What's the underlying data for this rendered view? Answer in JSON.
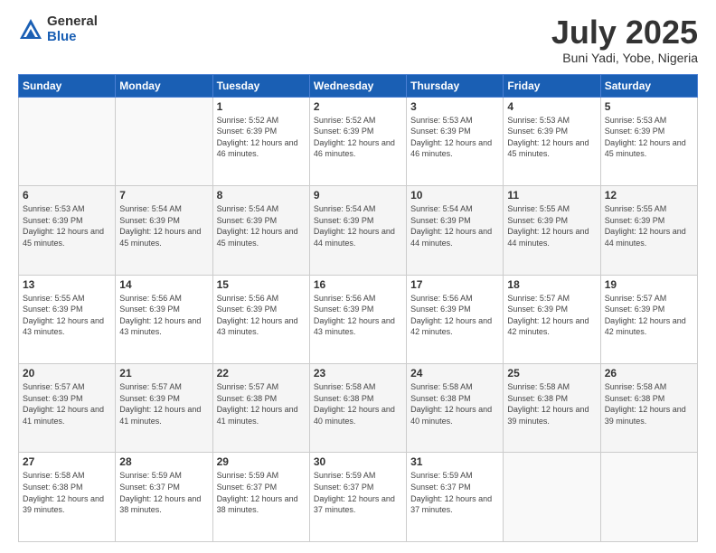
{
  "logo": {
    "general": "General",
    "blue": "Blue"
  },
  "header": {
    "month": "July 2025",
    "location": "Buni Yadi, Yobe, Nigeria"
  },
  "weekdays": [
    "Sunday",
    "Monday",
    "Tuesday",
    "Wednesday",
    "Thursday",
    "Friday",
    "Saturday"
  ],
  "days": [
    {
      "date": null
    },
    {
      "date": null
    },
    {
      "date": 1,
      "sunrise": "Sunrise: 5:52 AM",
      "sunset": "Sunset: 6:39 PM",
      "daylight": "Daylight: 12 hours and 46 minutes."
    },
    {
      "date": 2,
      "sunrise": "Sunrise: 5:52 AM",
      "sunset": "Sunset: 6:39 PM",
      "daylight": "Daylight: 12 hours and 46 minutes."
    },
    {
      "date": 3,
      "sunrise": "Sunrise: 5:53 AM",
      "sunset": "Sunset: 6:39 PM",
      "daylight": "Daylight: 12 hours and 46 minutes."
    },
    {
      "date": 4,
      "sunrise": "Sunrise: 5:53 AM",
      "sunset": "Sunset: 6:39 PM",
      "daylight": "Daylight: 12 hours and 45 minutes."
    },
    {
      "date": 5,
      "sunrise": "Sunrise: 5:53 AM",
      "sunset": "Sunset: 6:39 PM",
      "daylight": "Daylight: 12 hours and 45 minutes."
    },
    {
      "date": 6,
      "sunrise": "Sunrise: 5:53 AM",
      "sunset": "Sunset: 6:39 PM",
      "daylight": "Daylight: 12 hours and 45 minutes."
    },
    {
      "date": 7,
      "sunrise": "Sunrise: 5:54 AM",
      "sunset": "Sunset: 6:39 PM",
      "daylight": "Daylight: 12 hours and 45 minutes."
    },
    {
      "date": 8,
      "sunrise": "Sunrise: 5:54 AM",
      "sunset": "Sunset: 6:39 PM",
      "daylight": "Daylight: 12 hours and 45 minutes."
    },
    {
      "date": 9,
      "sunrise": "Sunrise: 5:54 AM",
      "sunset": "Sunset: 6:39 PM",
      "daylight": "Daylight: 12 hours and 44 minutes."
    },
    {
      "date": 10,
      "sunrise": "Sunrise: 5:54 AM",
      "sunset": "Sunset: 6:39 PM",
      "daylight": "Daylight: 12 hours and 44 minutes."
    },
    {
      "date": 11,
      "sunrise": "Sunrise: 5:55 AM",
      "sunset": "Sunset: 6:39 PM",
      "daylight": "Daylight: 12 hours and 44 minutes."
    },
    {
      "date": 12,
      "sunrise": "Sunrise: 5:55 AM",
      "sunset": "Sunset: 6:39 PM",
      "daylight": "Daylight: 12 hours and 44 minutes."
    },
    {
      "date": 13,
      "sunrise": "Sunrise: 5:55 AM",
      "sunset": "Sunset: 6:39 PM",
      "daylight": "Daylight: 12 hours and 43 minutes."
    },
    {
      "date": 14,
      "sunrise": "Sunrise: 5:56 AM",
      "sunset": "Sunset: 6:39 PM",
      "daylight": "Daylight: 12 hours and 43 minutes."
    },
    {
      "date": 15,
      "sunrise": "Sunrise: 5:56 AM",
      "sunset": "Sunset: 6:39 PM",
      "daylight": "Daylight: 12 hours and 43 minutes."
    },
    {
      "date": 16,
      "sunrise": "Sunrise: 5:56 AM",
      "sunset": "Sunset: 6:39 PM",
      "daylight": "Daylight: 12 hours and 43 minutes."
    },
    {
      "date": 17,
      "sunrise": "Sunrise: 5:56 AM",
      "sunset": "Sunset: 6:39 PM",
      "daylight": "Daylight: 12 hours and 42 minutes."
    },
    {
      "date": 18,
      "sunrise": "Sunrise: 5:57 AM",
      "sunset": "Sunset: 6:39 PM",
      "daylight": "Daylight: 12 hours and 42 minutes."
    },
    {
      "date": 19,
      "sunrise": "Sunrise: 5:57 AM",
      "sunset": "Sunset: 6:39 PM",
      "daylight": "Daylight: 12 hours and 42 minutes."
    },
    {
      "date": 20,
      "sunrise": "Sunrise: 5:57 AM",
      "sunset": "Sunset: 6:39 PM",
      "daylight": "Daylight: 12 hours and 41 minutes."
    },
    {
      "date": 21,
      "sunrise": "Sunrise: 5:57 AM",
      "sunset": "Sunset: 6:39 PM",
      "daylight": "Daylight: 12 hours and 41 minutes."
    },
    {
      "date": 22,
      "sunrise": "Sunrise: 5:57 AM",
      "sunset": "Sunset: 6:38 PM",
      "daylight": "Daylight: 12 hours and 41 minutes."
    },
    {
      "date": 23,
      "sunrise": "Sunrise: 5:58 AM",
      "sunset": "Sunset: 6:38 PM",
      "daylight": "Daylight: 12 hours and 40 minutes."
    },
    {
      "date": 24,
      "sunrise": "Sunrise: 5:58 AM",
      "sunset": "Sunset: 6:38 PM",
      "daylight": "Daylight: 12 hours and 40 minutes."
    },
    {
      "date": 25,
      "sunrise": "Sunrise: 5:58 AM",
      "sunset": "Sunset: 6:38 PM",
      "daylight": "Daylight: 12 hours and 39 minutes."
    },
    {
      "date": 26,
      "sunrise": "Sunrise: 5:58 AM",
      "sunset": "Sunset: 6:38 PM",
      "daylight": "Daylight: 12 hours and 39 minutes."
    },
    {
      "date": 27,
      "sunrise": "Sunrise: 5:58 AM",
      "sunset": "Sunset: 6:38 PM",
      "daylight": "Daylight: 12 hours and 39 minutes."
    },
    {
      "date": 28,
      "sunrise": "Sunrise: 5:59 AM",
      "sunset": "Sunset: 6:37 PM",
      "daylight": "Daylight: 12 hours and 38 minutes."
    },
    {
      "date": 29,
      "sunrise": "Sunrise: 5:59 AM",
      "sunset": "Sunset: 6:37 PM",
      "daylight": "Daylight: 12 hours and 38 minutes."
    },
    {
      "date": 30,
      "sunrise": "Sunrise: 5:59 AM",
      "sunset": "Sunset: 6:37 PM",
      "daylight": "Daylight: 12 hours and 37 minutes."
    },
    {
      "date": 31,
      "sunrise": "Sunrise: 5:59 AM",
      "sunset": "Sunset: 6:37 PM",
      "daylight": "Daylight: 12 hours and 37 minutes."
    },
    {
      "date": null
    },
    {
      "date": null
    }
  ]
}
